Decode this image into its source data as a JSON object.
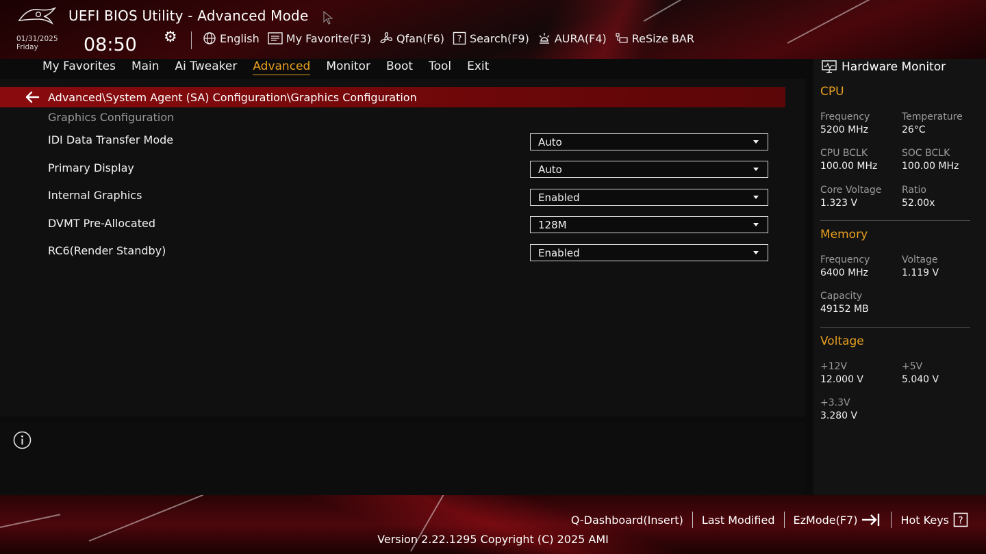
{
  "header": {
    "title": "UEFI BIOS Utility - Advanced Mode",
    "date": "01/31/2025",
    "day": "Friday",
    "time": "08:50",
    "tools": [
      {
        "label": "English",
        "icon": "globe-icon"
      },
      {
        "label": "My Favorite(F3)",
        "icon": "favorite-list-icon"
      },
      {
        "label": "Qfan(F6)",
        "icon": "fan-icon"
      },
      {
        "label": "Search(F9)",
        "icon": "search-question-icon"
      },
      {
        "label": "AURA(F4)",
        "icon": "aura-light-icon"
      },
      {
        "label": "ReSize BAR",
        "icon": "resize-bar-icon"
      }
    ]
  },
  "menu": {
    "items": [
      "My Favorites",
      "Main",
      "Ai Tweaker",
      "Advanced",
      "Monitor",
      "Boot",
      "Tool",
      "Exit"
    ],
    "active": "Advanced"
  },
  "breadcrumb": "Advanced\\System Agent (SA) Configuration\\Graphics Configuration",
  "section_title": "Graphics Configuration",
  "settings": [
    {
      "label": "IDI Data Transfer Mode",
      "value": "Auto"
    },
    {
      "label": "Primary Display",
      "value": "Auto"
    },
    {
      "label": "Internal Graphics",
      "value": "Enabled"
    },
    {
      "label": "DVMT Pre-Allocated",
      "value": "128M"
    },
    {
      "label": "RC6(Render Standby)",
      "value": "Enabled"
    }
  ],
  "hardware_monitor": {
    "title": "Hardware Monitor",
    "cpu": {
      "title": "CPU",
      "frequency_label": "Frequency",
      "frequency": "5200 MHz",
      "temperature_label": "Temperature",
      "temperature": "26°C",
      "cpu_bclk_label": "CPU BCLK",
      "cpu_bclk": "100.00 MHz",
      "soc_bclk_label": "SOC BCLK",
      "soc_bclk": "100.00 MHz",
      "core_voltage_label": "Core Voltage",
      "core_voltage": "1.323 V",
      "ratio_label": "Ratio",
      "ratio": "52.00x"
    },
    "memory": {
      "title": "Memory",
      "frequency_label": "Frequency",
      "frequency": "6400 MHz",
      "voltage_label": "Voltage",
      "voltage": "1.119 V",
      "capacity_label": "Capacity",
      "capacity": "49152 MB"
    },
    "voltage": {
      "title": "Voltage",
      "v12_label": "+12V",
      "v12": "12.000 V",
      "v5_label": "+5V",
      "v5": "5.040 V",
      "v33_label": "+3.3V",
      "v33": "3.280 V"
    }
  },
  "footer": {
    "q_dashboard": "Q-Dashboard(Insert)",
    "last_modified": "Last Modified",
    "ezmode": "EzMode(F7)",
    "hot_keys": "Hot Keys",
    "version": "Version 2.22.1295 Copyright (C) 2025 AMI"
  },
  "colors": {
    "accent": "#e9a020",
    "brand_red": "#8a0b0e"
  }
}
